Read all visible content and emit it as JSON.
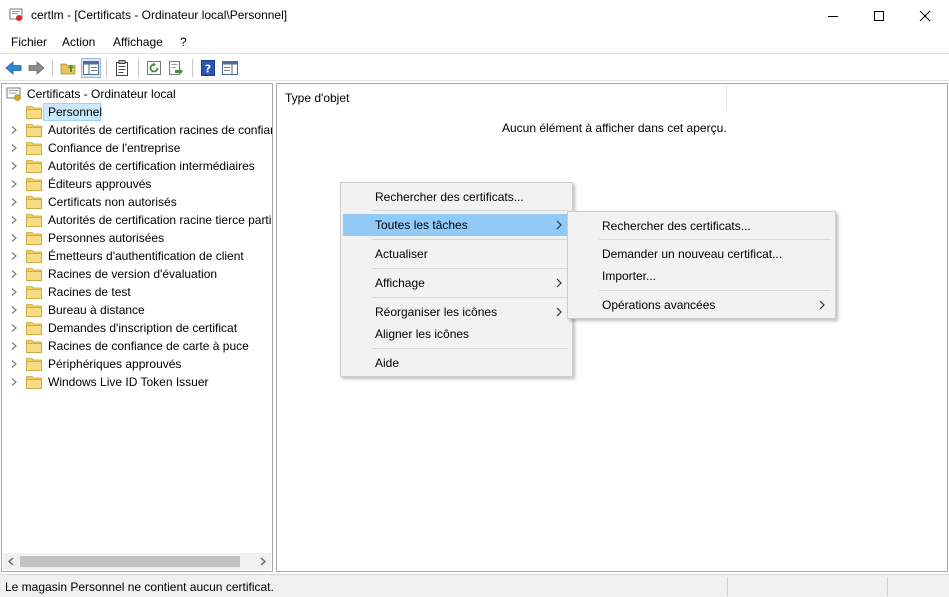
{
  "window": {
    "title": "certlm - [Certificats - Ordinateur local\\Personnel]",
    "icon": "certificate-manager-icon",
    "controls": [
      "minimize-icon",
      "maximize-icon",
      "close-icon"
    ]
  },
  "menubar": {
    "items": [
      "Fichier",
      "Action",
      "Affichage",
      "?"
    ]
  },
  "toolbar": {
    "buttons": [
      "back-icon",
      "forward-icon",
      "up-folder-icon",
      "show-hide-tree-icon",
      "properties-icon",
      "refresh-icon",
      "export-list-icon",
      "help-icon",
      "show-hide-action-pane-icon"
    ]
  },
  "tree": {
    "root": "Certificats - Ordinateur local",
    "items": [
      "Personnel",
      "Autorités de certification racines de confiar",
      "Confiance de l'entreprise",
      "Autorités de certification intermédiaires",
      "Éditeurs approuvés",
      "Certificats non autorisés",
      "Autorités de certification racine tierce parti",
      "Personnes autorisées",
      "Émetteurs d'authentification de client",
      "Racines de version d'évaluation",
      "Racines de test",
      "Bureau à distance",
      "Demandes d'inscription de certificat",
      "Racines de confiance de carte à puce",
      "Périphériques approuvés",
      "Windows Live ID Token Issuer"
    ],
    "selected": "Personnel"
  },
  "details": {
    "column_header": "Type d'objet",
    "empty_message": "Aucun élément à afficher dans cet aperçu."
  },
  "context_menu": {
    "items": [
      "Rechercher des certificats...",
      "Toutes les tâches",
      "Actualiser",
      "Affichage",
      "Réorganiser les icônes",
      "Aligner les icônes",
      "Aide"
    ],
    "highlighted": "Toutes les tâches"
  },
  "submenu": {
    "items": [
      "Rechercher des certificats...",
      "Demander un nouveau certificat...",
      "Importer...",
      "Opérations avancées"
    ]
  },
  "status": {
    "text": "Le magasin Personnel ne contient aucun certificat."
  },
  "colors": {
    "selection": "#cce8ff",
    "menu_highlight": "#91c9f7",
    "folder": "#f3cf61",
    "help_blue": "#2956b2"
  }
}
